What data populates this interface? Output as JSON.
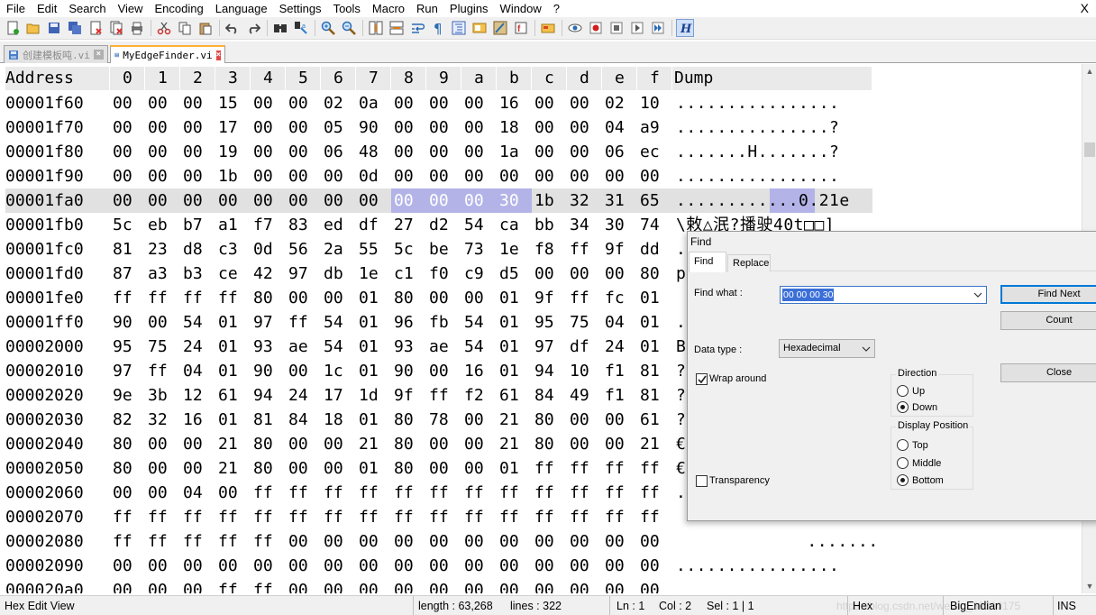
{
  "menu": [
    "File",
    "Edit",
    "Search",
    "View",
    "Encoding",
    "Language",
    "Settings",
    "Tools",
    "Macro",
    "Run",
    "Plugins",
    "Window",
    "?"
  ],
  "close_glyph": "X",
  "toolbar_icons": [
    "new-file-icon",
    "open-file-icon",
    "save-icon",
    "save-all-icon",
    "close-icon",
    "close-all-icon",
    "print-icon",
    "cut-icon",
    "copy-icon",
    "paste-icon",
    "undo-icon",
    "redo-icon",
    "find-icon",
    "replace-icon",
    "zoom-in-icon",
    "zoom-out-icon",
    "sync-vertical-icon",
    "sync-horizontal-icon",
    "word-wrap-icon",
    "show-all-chars-icon",
    "indent-guide-icon",
    "doc-map-icon",
    "function-list-icon",
    "folder-workspace-icon",
    "monitor-icon",
    "record-macro-icon",
    "stop-record-icon",
    "play-macro-icon",
    "run-macro-multiple-icon",
    "save-macro-icon",
    "hex-editor-icon"
  ],
  "tabs": [
    {
      "label": "创建模板吨.vi",
      "active": false
    },
    {
      "label": "MyEdgeFinder.vi",
      "active": true
    }
  ],
  "hex": {
    "header": [
      "Address",
      "0",
      "1",
      "2",
      "3",
      "4",
      "5",
      "6",
      "7",
      "8",
      "9",
      "a",
      "b",
      "c",
      "d",
      "e",
      "f",
      "Dump"
    ],
    "rows": [
      {
        "addr": "00001f60",
        "bytes": [
          "00",
          "00",
          "00",
          "15",
          "00",
          "00",
          "02",
          "0a",
          "00",
          "00",
          "00",
          "16",
          "00",
          "00",
          "02",
          "10"
        ],
        "dump": "................"
      },
      {
        "addr": "00001f70",
        "bytes": [
          "00",
          "00",
          "00",
          "17",
          "00",
          "00",
          "05",
          "90",
          "00",
          "00",
          "00",
          "18",
          "00",
          "00",
          "04",
          "a9"
        ],
        "dump": "...............?"
      },
      {
        "addr": "00001f80",
        "bytes": [
          "00",
          "00",
          "00",
          "19",
          "00",
          "00",
          "06",
          "48",
          "00",
          "00",
          "00",
          "1a",
          "00",
          "00",
          "06",
          "ec"
        ],
        "dump": ".......H.......?"
      },
      {
        "addr": "00001f90",
        "bytes": [
          "00",
          "00",
          "00",
          "1b",
          "00",
          "00",
          "00",
          "0d",
          "00",
          "00",
          "00",
          "00",
          "00",
          "00",
          "00",
          "00"
        ],
        "dump": "................"
      },
      {
        "addr": "00001fa0",
        "bytes": [
          "00",
          "00",
          "00",
          "00",
          "00",
          "00",
          "00",
          "00",
          "00",
          "00",
          "00",
          "30",
          "1b",
          "32",
          "31",
          "65"
        ],
        "dump": "............0.21e"
      },
      {
        "addr": "00001fb0",
        "bytes": [
          "5c",
          "eb",
          "b7",
          "a1",
          "f7",
          "83",
          "ed",
          "df",
          "27",
          "d2",
          "54",
          "ca",
          "bb",
          "34",
          "30",
          "74"
        ],
        "dump": "\\敕△泯?播驶40t□□]"
      },
      {
        "addr": "00001fc0",
        "bytes": [
          "81",
          "23",
          "d8",
          "c3",
          "0d",
          "56",
          "2a",
          "55",
          "5c",
          "be",
          "73",
          "1e",
          "f8",
          "ff",
          "9f",
          "dd"
        ],
        "dump": ""
      },
      {
        "addr": "00001fd0",
        "bytes": [
          "87",
          "a3",
          "b3",
          "ce",
          "42",
          "97",
          "db",
          "1e",
          "c1",
          "f0",
          "c9",
          "d5",
          "00",
          "00",
          "00",
          "80"
        ],
        "dump": ""
      },
      {
        "addr": "00001fe0",
        "bytes": [
          "ff",
          "ff",
          "ff",
          "ff",
          "80",
          "00",
          "00",
          "01",
          "80",
          "00",
          "00",
          "01",
          "9f",
          "ff",
          "fc",
          "01"
        ],
        "dump": ""
      },
      {
        "addr": "00001ff0",
        "bytes": [
          "90",
          "00",
          "54",
          "01",
          "97",
          "ff",
          "54",
          "01",
          "96",
          "fb",
          "54",
          "01",
          "95",
          "75",
          "04",
          "01"
        ],
        "dump": ""
      },
      {
        "addr": "00002000",
        "bytes": [
          "95",
          "75",
          "24",
          "01",
          "93",
          "ae",
          "54",
          "01",
          "93",
          "ae",
          "54",
          "01",
          "97",
          "df",
          "24",
          "01"
        ],
        "dump": ""
      },
      {
        "addr": "00002010",
        "bytes": [
          "97",
          "ff",
          "04",
          "01",
          "90",
          "00",
          "1c",
          "01",
          "90",
          "00",
          "16",
          "01",
          "94",
          "10",
          "f1",
          "81"
        ],
        "dump": ""
      },
      {
        "addr": "00002020",
        "bytes": [
          "9e",
          "3b",
          "12",
          "61",
          "94",
          "24",
          "17",
          "1d",
          "9f",
          "ff",
          "f2",
          "61",
          "84",
          "49",
          "f1",
          "81"
        ],
        "dump": ""
      },
      {
        "addr": "00002030",
        "bytes": [
          "82",
          "32",
          "16",
          "01",
          "81",
          "84",
          "18",
          "01",
          "80",
          "78",
          "00",
          "21",
          "80",
          "00",
          "00",
          "61"
        ],
        "dump": ""
      },
      {
        "addr": "00002040",
        "bytes": [
          "80",
          "00",
          "00",
          "21",
          "80",
          "00",
          "00",
          "21",
          "80",
          "00",
          "00",
          "21",
          "80",
          "00",
          "00",
          "21"
        ],
        "dump": ""
      },
      {
        "addr": "00002050",
        "bytes": [
          "80",
          "00",
          "00",
          "21",
          "80",
          "00",
          "00",
          "01",
          "80",
          "00",
          "00",
          "01",
          "ff",
          "ff",
          "ff",
          "ff"
        ],
        "dump": ""
      },
      {
        "addr": "00002060",
        "bytes": [
          "00",
          "00",
          "04",
          "00",
          "ff",
          "ff",
          "ff",
          "ff",
          "ff",
          "ff",
          "ff",
          "ff",
          "ff",
          "ff",
          "ff",
          "ff"
        ],
        "dump": ""
      },
      {
        "addr": "00002070",
        "bytes": [
          "ff",
          "ff",
          "ff",
          "ff",
          "ff",
          "ff",
          "ff",
          "ff",
          "ff",
          "ff",
          "ff",
          "ff",
          "ff",
          "ff",
          "ff",
          "ff"
        ],
        "dump": ""
      },
      {
        "addr": "00002080",
        "bytes": [
          "ff",
          "ff",
          "ff",
          "ff",
          "ff",
          "00",
          "00",
          "00",
          "00",
          "00",
          "00",
          "00",
          "00",
          "00",
          "00",
          "00"
        ],
        "dump": "       ......."
      },
      {
        "addr": "00002090",
        "bytes": [
          "00",
          "00",
          "00",
          "00",
          "00",
          "00",
          "00",
          "00",
          "00",
          "00",
          "00",
          "00",
          "00",
          "00",
          "00",
          "00"
        ],
        "dump": "................"
      },
      {
        "addr": "000020a0",
        "bytes": [
          "00",
          "00",
          "00",
          "ff",
          "ff",
          "00",
          "00",
          "00",
          "00",
          "00",
          "00",
          "00",
          "00",
          "00",
          "00",
          "00"
        ],
        "dump": ""
      }
    ],
    "partial_dump_glyphs": {
      "6": ".",
      "7": "p",
      "8": "",
      "9": ".",
      "10": "B",
      "11": "?",
      "12": "?",
      "13": "?",
      "14": "€",
      "15": "€",
      "16": "."
    }
  },
  "find_dialog": {
    "title": "Find",
    "tab_find": "Find",
    "tab_replace": "Replace",
    "find_what_label": "Find what :",
    "find_what_value": "00 00 00 30",
    "data_type_label": "Data type :",
    "data_type_value": "Hexadecimal",
    "wrap_around": "Wrap around",
    "transparency": "Transparency",
    "direction_title": "Direction",
    "dir_up": "Up",
    "dir_down": "Down",
    "display_position_title": "Display Position",
    "pos_top": "Top",
    "pos_middle": "Middle",
    "pos_bottom": "Bottom",
    "btn_find_next": "Find Next",
    "btn_count": "Count",
    "btn_close": "Close"
  },
  "status": {
    "mode": "Hex Edit View",
    "length": "length : 63,268",
    "lines": "lines : 322",
    "ln": "Ln : 1",
    "col": "Col : 2",
    "sel": "Sel : 1 | 1",
    "view": "Hex",
    "endian": "BigEndian",
    "ins": "INS",
    "watermark": "https://blog.csdn.net/weixin_39380175"
  },
  "colors": {
    "selection": "#b3b3e8",
    "find_value_bg": "#3b6fd8",
    "active_tab_accent": "#ffb03a"
  }
}
